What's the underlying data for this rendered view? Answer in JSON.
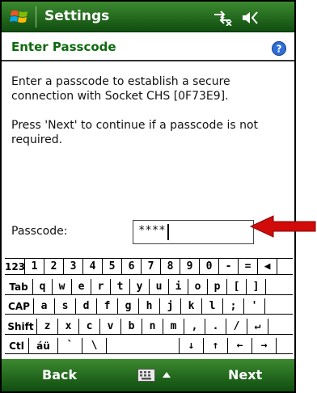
{
  "titlebar": {
    "title": "Settings",
    "start_icon": "windows-flag-icon",
    "connectivity_icon": "connection-disconnected-icon",
    "volume_icon": "speaker-icon"
  },
  "header": {
    "title": "Enter Passcode",
    "help_icon": "help-icon"
  },
  "content": {
    "para1": "Enter a passcode to establish a secure connection with Socket CHS [0F73E9].",
    "para2": "Press 'Next' to continue if a passcode is not required."
  },
  "passcode": {
    "label": "Passcode:",
    "value": "****"
  },
  "keyboard": {
    "rows": [
      [
        "123",
        "1",
        "2",
        "3",
        "4",
        "5",
        "6",
        "7",
        "8",
        "9",
        "0",
        "-",
        "=",
        "◀"
      ],
      [
        "Tab",
        "q",
        "w",
        "e",
        "r",
        "t",
        "y",
        "u",
        "i",
        "o",
        "p",
        "[",
        "]"
      ],
      [
        "CAP",
        "a",
        "s",
        "d",
        "f",
        "g",
        "h",
        "j",
        "k",
        "l",
        ";",
        "'"
      ],
      [
        "Shift",
        "z",
        "x",
        "c",
        "v",
        "b",
        "n",
        "m",
        ",",
        ".",
        "/",
        "↵"
      ],
      [
        "Ctl",
        "áü",
        "`",
        "\\",
        "",
        "↓",
        "↑",
        "←",
        "→"
      ]
    ]
  },
  "softkeys": {
    "left": "Back",
    "right": "Next",
    "keyboard_icon": "keyboard-icon"
  },
  "colors": {
    "bar_green_top": "#3c8a2f",
    "bar_green_bottom": "#0f4d10",
    "header_text": "#0e6a0e",
    "arrow": "#d10a0a"
  }
}
